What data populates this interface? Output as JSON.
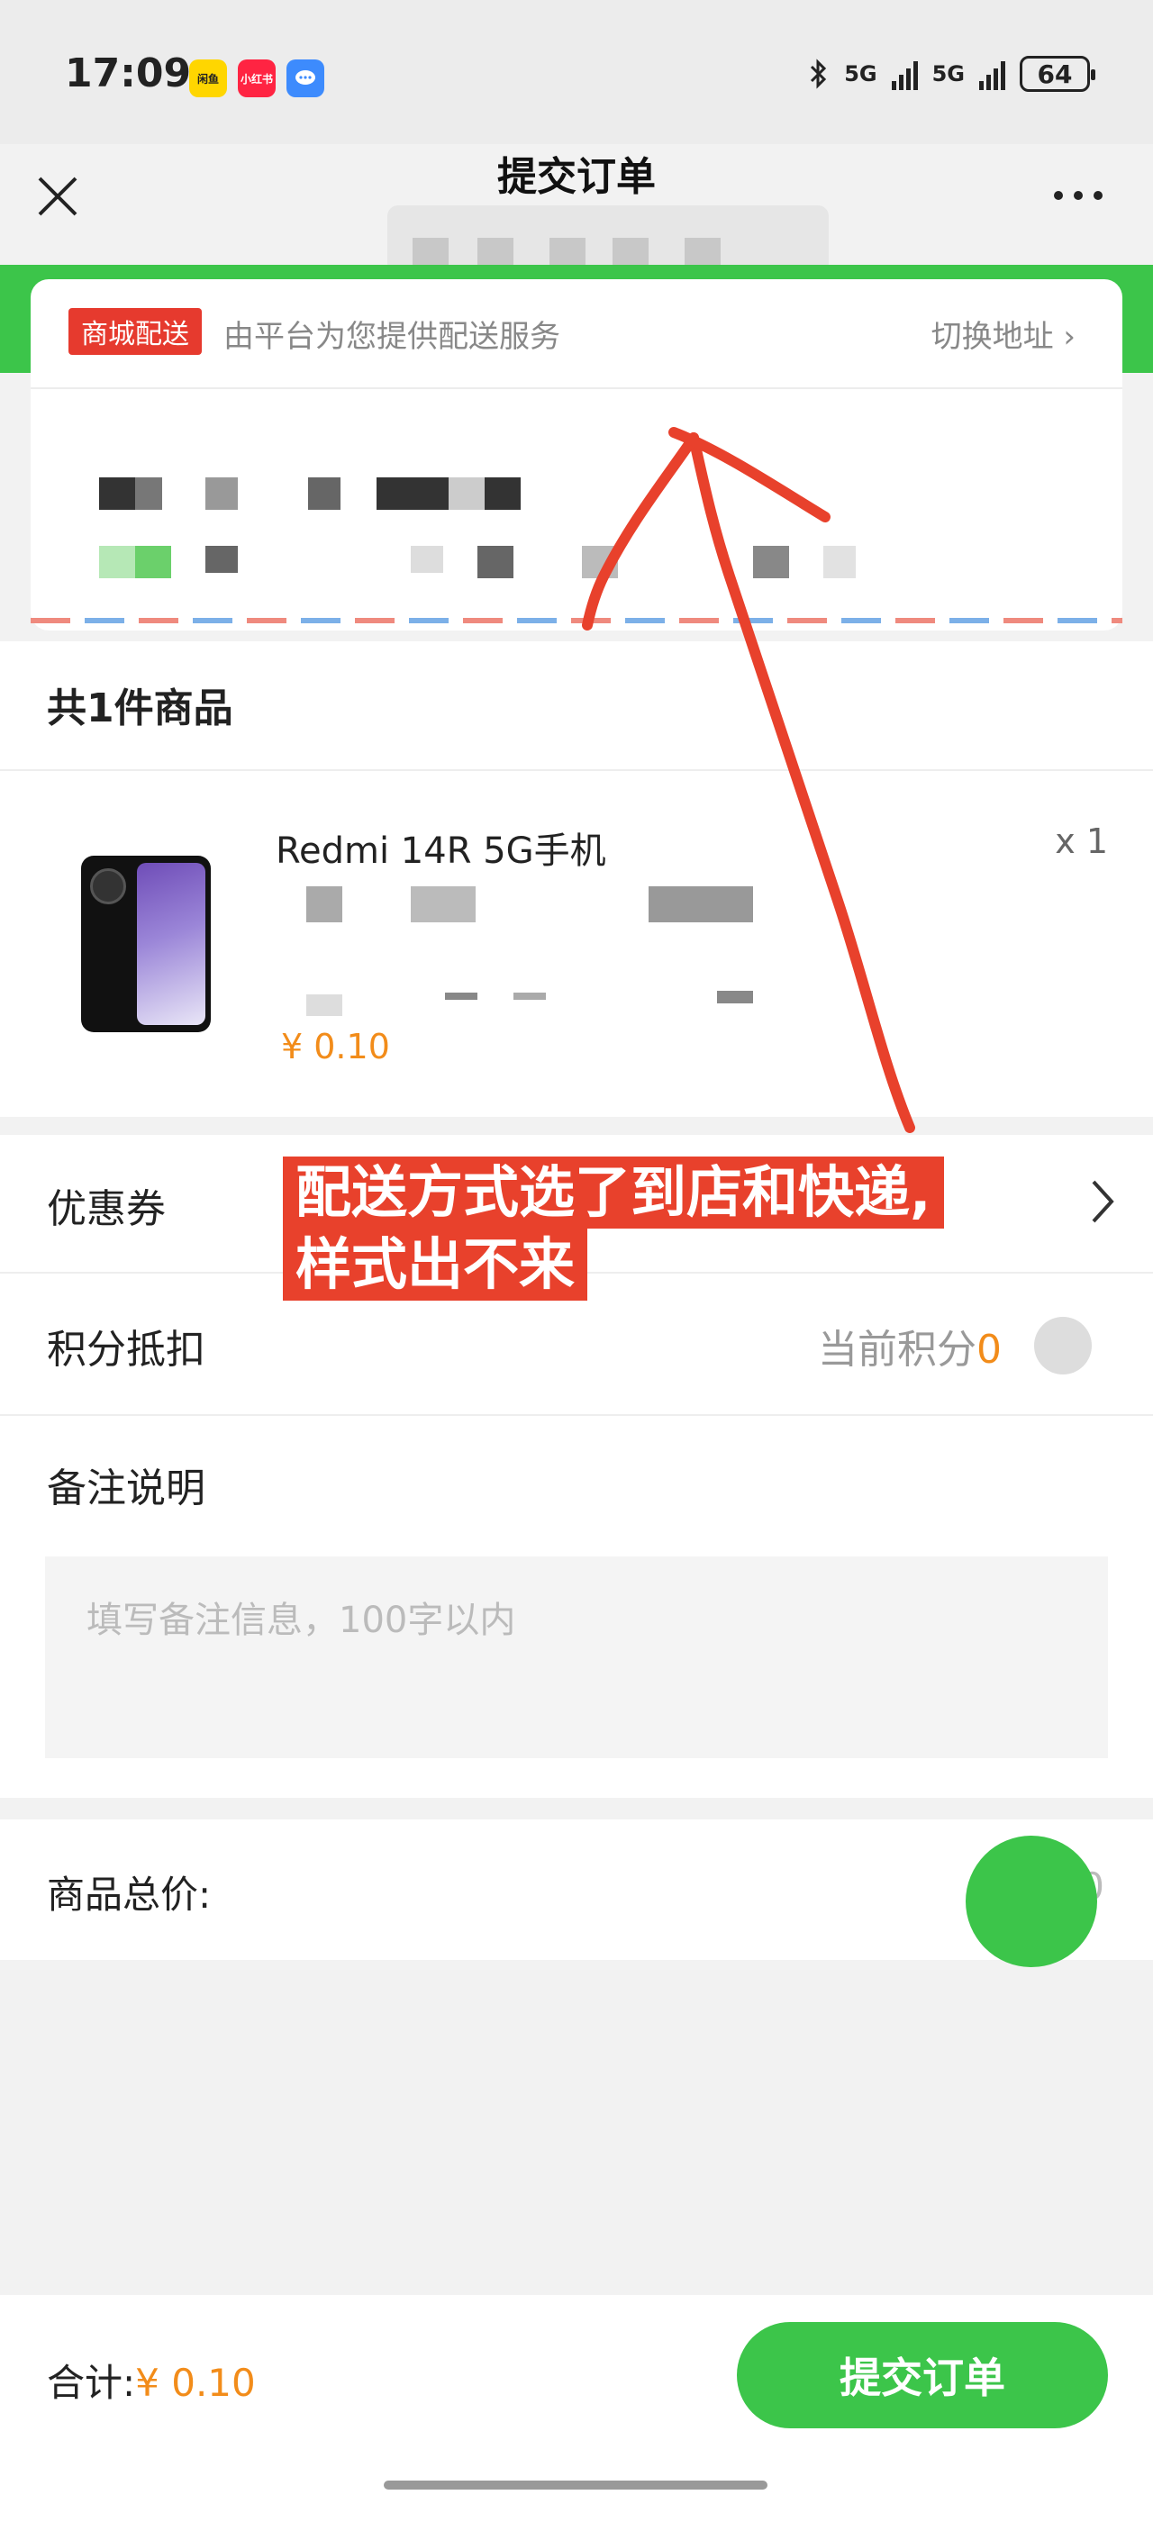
{
  "status_bar": {
    "time": "17:09",
    "app_badges": [
      {
        "icon": "yellow-app-icon",
        "label": "闲鱼",
        "color": "#ffd600"
      },
      {
        "icon": "red-app-icon",
        "label": "小红书",
        "color": "#ff2442"
      },
      {
        "icon": "chat-app-icon",
        "label": "",
        "color": "#3d8bfd"
      }
    ],
    "network_1": "5G",
    "network_2": "5G",
    "battery": "64"
  },
  "nav": {
    "title": "提交订单"
  },
  "delivery": {
    "tag": "商城配送",
    "hint": "由平台为您提供配送服务",
    "switch_address": "切换地址"
  },
  "goods": {
    "header": "共1件商品",
    "item": {
      "name": "Redmi 14R 5G手机",
      "qty": "x 1",
      "price": "¥ 0.10"
    }
  },
  "coupon": {
    "label": "优惠券"
  },
  "points": {
    "label": "积分抵扣",
    "current_label": "当前积分",
    "current_value": "0"
  },
  "remark": {
    "label": "备注说明",
    "placeholder": "填写备注信息，100字以内"
  },
  "total": {
    "label": "商品总价:",
    "value": "0"
  },
  "footer": {
    "sum_label": "合计:",
    "sum_value": "¥ 0.10",
    "submit": "提交订单"
  },
  "annotation": {
    "line1": "配送方式选了到店和快递,",
    "line2": "样式出不来",
    "color": "#e8412c"
  },
  "colors": {
    "brand_green": "#3cc54a",
    "price_orange": "#f28c1a",
    "tag_red": "#e63a2e"
  }
}
